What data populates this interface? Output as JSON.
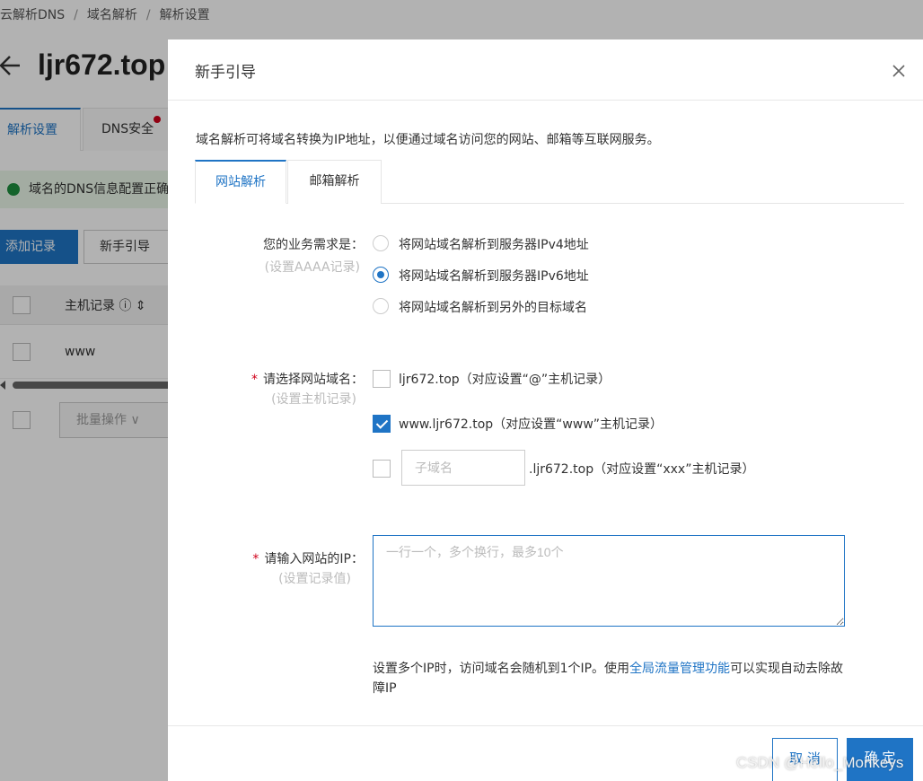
{
  "background": {
    "breadcrumb": [
      "云解析DNS",
      "域名解析",
      "解析设置"
    ],
    "domain_title": "ljr672.top",
    "tabs": [
      {
        "label": "解析设置",
        "active": true
      },
      {
        "label": "DNS安全",
        "badge_dot": true
      }
    ],
    "notice": "域名的DNS信息配置正确",
    "buttons": {
      "add_record": "添加记录",
      "guide": "新手引导"
    },
    "table": {
      "column_host": "主机记录",
      "rows": [
        {
          "host": "www"
        }
      ]
    },
    "batch_ops": "批量操作"
  },
  "modal": {
    "title": "新手引导",
    "intro": "域名解析可将域名转换为IP地址，以便通过域名访问您的网站、邮箱等互联网服务。",
    "tabs": [
      {
        "label": "网站解析",
        "active": true
      },
      {
        "label": "邮箱解析",
        "active": false
      }
    ],
    "business": {
      "label": "您的业务需求是：",
      "sublabel": "(设置AAAA记录)",
      "options": [
        {
          "label": "将网站域名解析到服务器IPv4地址",
          "selected": false
        },
        {
          "label": "将网站域名解析到服务器IPv6地址",
          "selected": true
        },
        {
          "label": "将网站域名解析到另外的目标域名",
          "selected": false
        }
      ]
    },
    "domain_select": {
      "required_mark": "*",
      "label": "请选择网站域名：",
      "sublabel": "(设置主机记录)",
      "options": [
        {
          "label": "ljr672.top（对应设置“@”主机记录）",
          "checked": false
        },
        {
          "label": "www.ljr672.top（对应设置“www”主机记录）",
          "checked": true
        }
      ],
      "subdomain": {
        "placeholder": "子域名",
        "value": "",
        "suffix": ".ljr672.top（对应设置“xxx”主机记录）",
        "checked": false
      }
    },
    "ip_input": {
      "required_mark": "*",
      "label": "请输入网站的IP：",
      "sublabel": "(设置记录值)",
      "placeholder": "一行一个，多个换行，最多10个",
      "value": ""
    },
    "hint": {
      "before": "设置多个IP时，访问域名会随机到1个IP。使用",
      "link": "全局流量管理功能",
      "after": "可以实现自动去除故障IP"
    },
    "buttons": {
      "cancel": "取 消",
      "ok": "确 定"
    }
  },
  "watermark": "CSDN @Hello_Monkeys",
  "colors": {
    "primary": "#1f74c5",
    "required": "#d0021b",
    "success": "#1e8e3e"
  }
}
